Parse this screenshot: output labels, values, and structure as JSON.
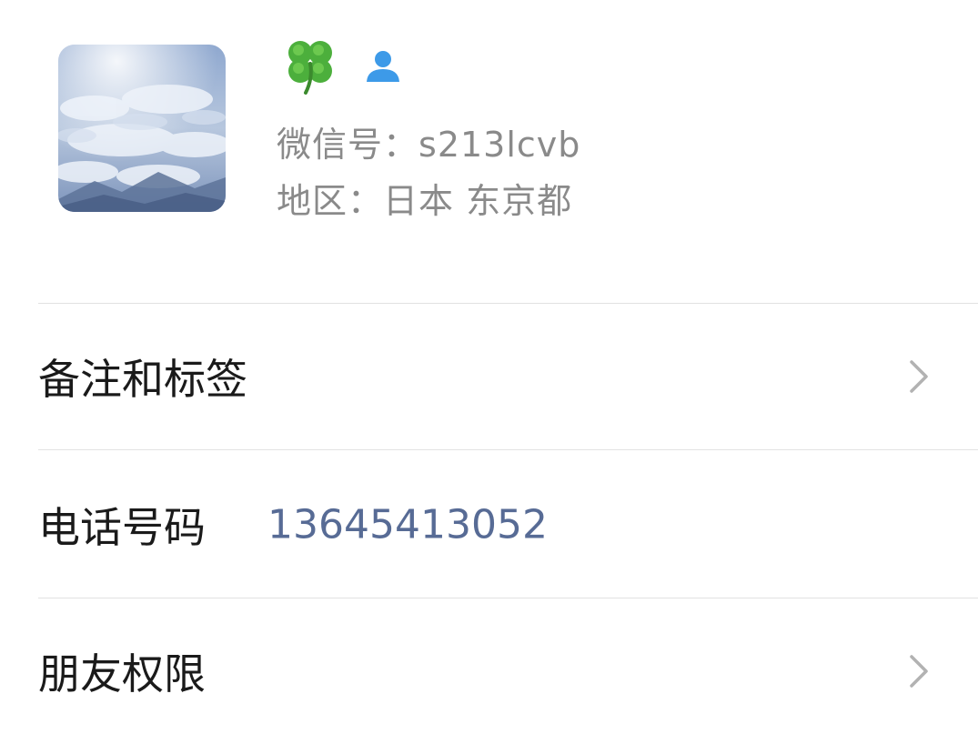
{
  "profile": {
    "nickname_emoji": "🍀",
    "wechat_id_label": "微信号：",
    "wechat_id_value": "s213lcvb",
    "region_label": "地区：",
    "region_value": "日本 东京都"
  },
  "rows": [
    {
      "label": "备注和标签",
      "value": "",
      "has_chevron": true
    },
    {
      "label": "电话号码",
      "value": "13645413052",
      "has_chevron": false
    },
    {
      "label": "朋友权限",
      "value": "",
      "has_chevron": true
    }
  ],
  "colors": {
    "link_blue": "#576b95",
    "secondary_text": "#8a8a8a",
    "divider": "#e2e2e2",
    "chevron": "#b2b2b2",
    "contact_icon": "#3d9ae8"
  }
}
